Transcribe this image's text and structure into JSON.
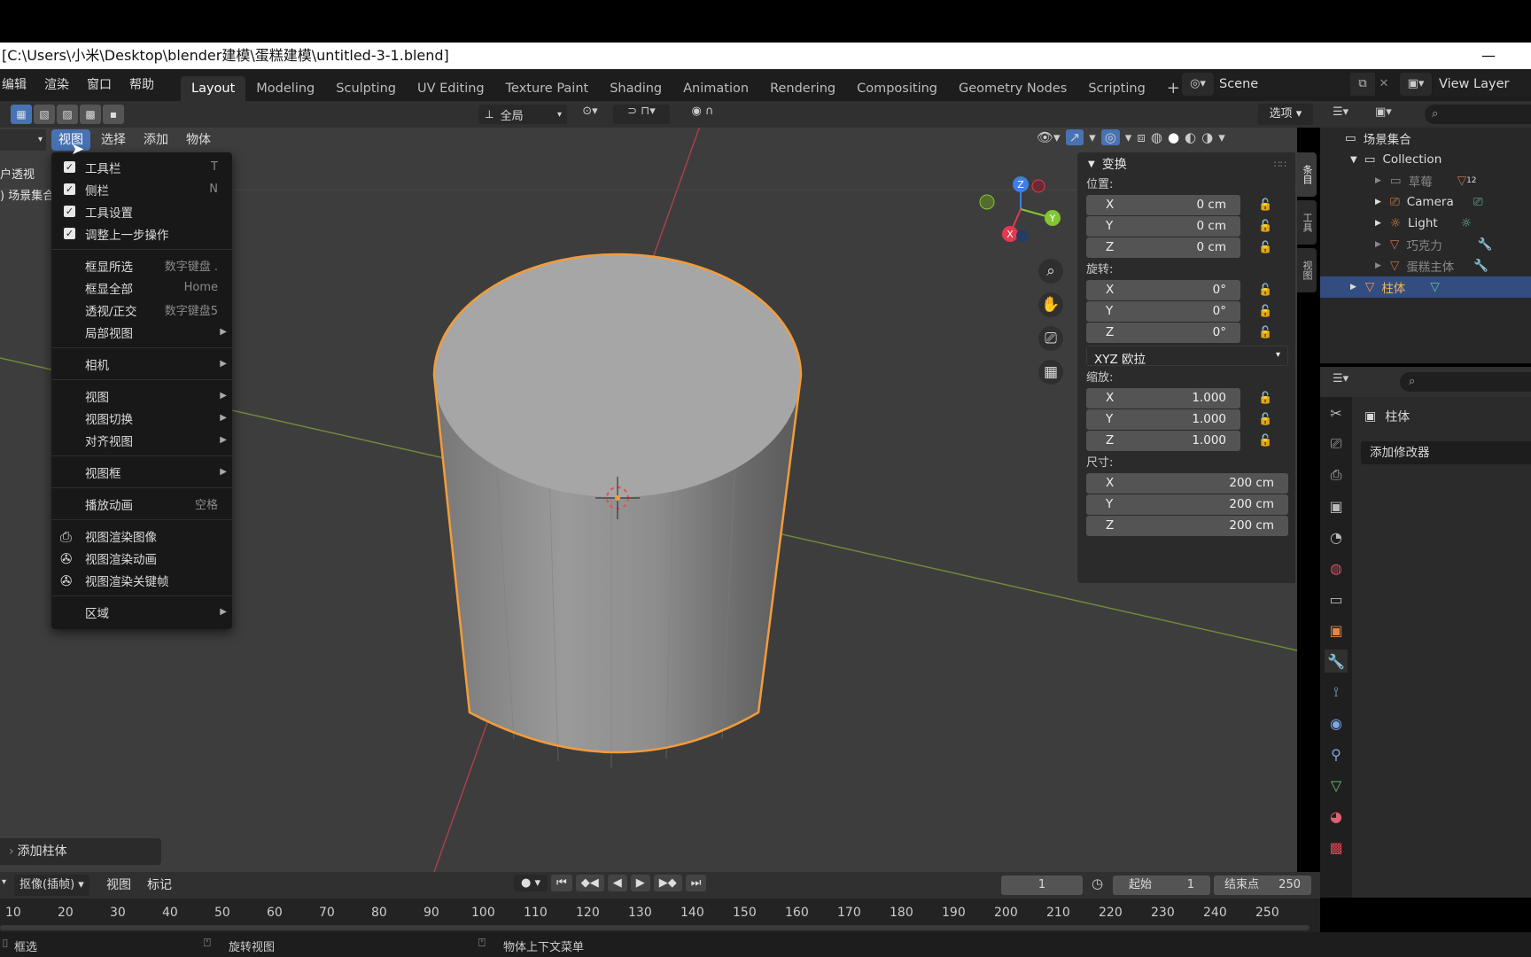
{
  "window": {
    "title": "[C:\\Users\\小米\\Desktop\\blender建模\\蛋糕建模\\untitled-3-1.blend]",
    "minimize_glyph": "—"
  },
  "topmenu": {
    "items": [
      "编辑",
      "渲染",
      "窗口",
      "帮助"
    ],
    "workspaces": [
      "Layout",
      "Modeling",
      "Sculpting",
      "UV Editing",
      "Texture Paint",
      "Shading",
      "Animation",
      "Rendering",
      "Compositing",
      "Geometry Nodes",
      "Scripting"
    ],
    "add_tab": "+",
    "scene": "Scene",
    "view_layer": "View Layer"
  },
  "viewport_header": {
    "transform_orient": "全局",
    "options": "选项",
    "menus": [
      "视图",
      "选择",
      "添加",
      "物体"
    ]
  },
  "overlay_text": {
    "view_name": "户透视",
    "collection": ") 场景集合"
  },
  "view_menu": {
    "items": [
      {
        "label": "工具栏",
        "shortcut": "T",
        "check": true
      },
      {
        "label": "侧栏",
        "shortcut": "N",
        "check": true
      },
      {
        "label": "工具设置",
        "shortcut": "",
        "check": true
      },
      {
        "label": "调整上一步操作",
        "shortcut": "",
        "check": true
      },
      {
        "label": "框显所选",
        "shortcut": "数字键盘 ."
      },
      {
        "label": "框显全部",
        "shortcut": "Home"
      },
      {
        "label": "透视/正交",
        "shortcut": "数字键盘5"
      },
      {
        "label": "局部视图",
        "submenu": true
      },
      {
        "label": "相机",
        "submenu": true
      },
      {
        "label": "视图",
        "submenu": true
      },
      {
        "label": "视图切换",
        "submenu": true
      },
      {
        "label": "对齐视图",
        "submenu": true
      },
      {
        "label": "视图框",
        "submenu": true
      },
      {
        "label": "播放动画",
        "shortcut": "空格"
      },
      {
        "label": "视图渲染图像"
      },
      {
        "label": "视图渲染动画"
      },
      {
        "label": "视图渲染关键帧"
      },
      {
        "label": "区域",
        "submenu": true
      }
    ]
  },
  "n_panel": {
    "title": "变换",
    "location_label": "位置:",
    "location": {
      "x": "0 cm",
      "y": "0 cm",
      "z": "0 cm"
    },
    "rotation_label": "旋转:",
    "rotation": {
      "x": "0°",
      "y": "0°",
      "z": "0°"
    },
    "rotation_mode": "XYZ 欧拉",
    "scale_label": "缩放:",
    "scale": {
      "x": "1.000",
      "y": "1.000",
      "z": "1.000"
    },
    "dimensions_label": "尺寸:",
    "dimensions": {
      "x": "200 cm",
      "y": "200 cm",
      "z": "200 cm"
    },
    "axis": {
      "x": "X",
      "y": "Y",
      "z": "Z"
    },
    "tabs": [
      "条目",
      "工具",
      "视图"
    ]
  },
  "gizmo": {
    "x": "X",
    "y": "Y",
    "z": "Z"
  },
  "outliner": {
    "root": "场景集合",
    "collection": "Collection",
    "items": [
      {
        "name": "草莓",
        "dim": true,
        "badge": "12"
      },
      {
        "name": "Camera",
        "dim": false
      },
      {
        "name": "Light",
        "dim": false
      },
      {
        "name": "巧克力",
        "dim": true
      },
      {
        "name": "蛋糕主体",
        "dim": true
      },
      {
        "name": "柱体",
        "dim": false,
        "selected": true
      }
    ]
  },
  "properties": {
    "object_name": "柱体",
    "add_modifier": "添加修改器"
  },
  "last_operator": "添加柱体",
  "timeline": {
    "mode": "抠像(插帧)",
    "menus": [
      "视图",
      "标记"
    ],
    "current_frame": "1",
    "start_label": "起始",
    "start": "1",
    "end_label": "结束点",
    "end": "250",
    "ticks": [
      "10",
      "20",
      "30",
      "40",
      "50",
      "60",
      "70",
      "80",
      "90",
      "100",
      "110",
      "120",
      "130",
      "140",
      "150",
      "160",
      "170",
      "180",
      "190",
      "200",
      "210",
      "220",
      "230",
      "240",
      "250"
    ]
  },
  "status": {
    "left": "框选",
    "middle": "旋转视图",
    "right": "物体上下文菜单"
  },
  "colors": {
    "accent": "#4772b3",
    "selected_outline": "#f39c3a",
    "x_axis": "#e5394f",
    "y_axis": "#82c630",
    "z_axis": "#3d7fe3"
  }
}
